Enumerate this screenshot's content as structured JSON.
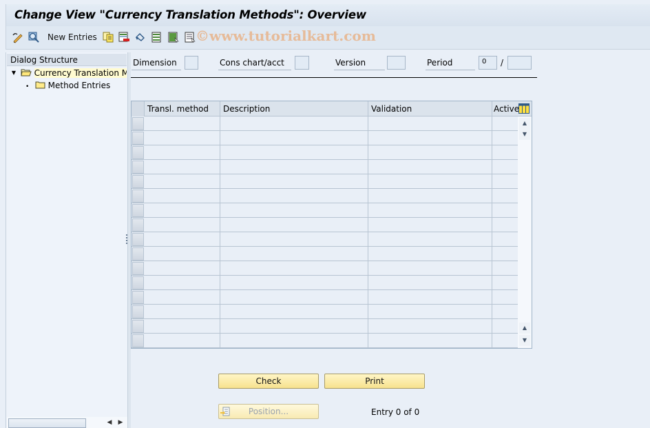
{
  "window": {
    "title": "Change View \"Currency Translation Methods\": Overview",
    "watermark": "©www.tutorialkart.com"
  },
  "toolbar": {
    "items": [
      {
        "icon": "display-change-icon",
        "label": ""
      },
      {
        "icon": "find-icon",
        "label": ""
      },
      {
        "icon": "",
        "label": "New Entries"
      },
      {
        "icon": "copy-as-icon",
        "label": ""
      },
      {
        "icon": "delete-icon",
        "label": ""
      },
      {
        "icon": "undo-change-icon",
        "label": ""
      },
      {
        "icon": "select-all-icon",
        "label": ""
      },
      {
        "icon": "select-block-icon",
        "label": ""
      },
      {
        "icon": "deselect-all-icon",
        "label": ""
      }
    ],
    "new_entries_label": "New Entries"
  },
  "dialog_structure": {
    "header": "Dialog Structure",
    "items": [
      {
        "label": "Currency Translation Methods",
        "display": "Currency Translation Met",
        "expanded": true,
        "selected": true,
        "level": 0
      },
      {
        "label": "Method Entries",
        "display": "Method Entries",
        "expanded": false,
        "selected": false,
        "level": 1
      }
    ]
  },
  "selection_fields": {
    "dimension": {
      "label": "Dimension",
      "value": ""
    },
    "cons_chart": {
      "label": "Cons chart/acct",
      "value": ""
    },
    "version": {
      "label": "Version",
      "value": ""
    },
    "period": {
      "label": "Period",
      "value": "0",
      "separator": "/",
      "year": ""
    }
  },
  "table": {
    "columns": [
      "Transl. method",
      "Description",
      "Validation",
      "Active"
    ],
    "rows": [],
    "visible_empty_rows": 16
  },
  "buttons": {
    "check": "Check",
    "print": "Print",
    "position": "Position..."
  },
  "status": {
    "entry_text": "Entry 0 of 0"
  }
}
